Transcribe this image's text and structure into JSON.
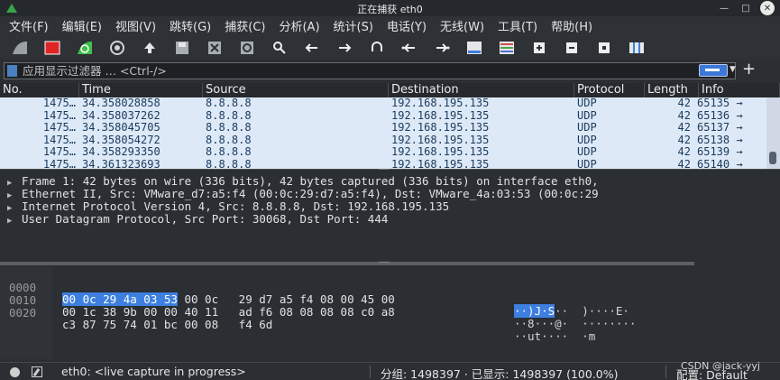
{
  "window": {
    "title": "正在捕获 eth0"
  },
  "menu": [
    "文件(F)",
    "编辑(E)",
    "视图(V)",
    "跳转(G)",
    "捕获(C)",
    "分析(A)",
    "统计(S)",
    "电话(Y)",
    "无线(W)",
    "工具(T)",
    "帮助(H)"
  ],
  "toolbar": {
    "icons": [
      "shark-fin-start-icon",
      "stop-capture-icon",
      "restart-capture-icon",
      "capture-options-icon",
      "open-file-icon",
      "save-file-icon",
      "close-file-icon",
      "reload-file-icon",
      "find-packet-icon",
      "go-back-icon",
      "go-forward-icon",
      "go-to-packet-icon",
      "first-packet-icon",
      "last-packet-icon",
      "auto-scroll-icon",
      "colorize-icon",
      "zoom-in-icon",
      "zoom-out-icon",
      "normal-size-icon",
      "resize-columns-icon"
    ]
  },
  "filter": {
    "placeholder": "应用显示过滤器 … <Ctrl-/>",
    "value": ""
  },
  "packet_list": {
    "columns": [
      "No.",
      "Time",
      "Source",
      "Destination",
      "Protocol",
      "Length",
      "Info"
    ],
    "rows": [
      {
        "no": "1475…",
        "time": "34.358028858",
        "src": "8.8.8.8",
        "dst": "192.168.195.135",
        "proto": "UDP",
        "len": "42",
        "info": "65135 →"
      },
      {
        "no": "1475…",
        "time": "34.358037262",
        "src": "8.8.8.8",
        "dst": "192.168.195.135",
        "proto": "UDP",
        "len": "42",
        "info": "65136 →"
      },
      {
        "no": "1475…",
        "time": "34.358045705",
        "src": "8.8.8.8",
        "dst": "192.168.195.135",
        "proto": "UDP",
        "len": "42",
        "info": "65137 →"
      },
      {
        "no": "1475…",
        "time": "34.358054272",
        "src": "8.8.8.8",
        "dst": "192.168.195.135",
        "proto": "UDP",
        "len": "42",
        "info": "65138 →"
      },
      {
        "no": "1475…",
        "time": "34.358293350",
        "src": "8.8.8.8",
        "dst": "192.168.195.135",
        "proto": "UDP",
        "len": "42",
        "info": "65139 →"
      },
      {
        "no": "1475…",
        "time": "34.361323693",
        "src": "8.8.8.8",
        "dst": "192.168.195.135",
        "proto": "UDP",
        "len": "42",
        "info": "65140 →"
      }
    ]
  },
  "details": [
    "Frame 1: 42 bytes on wire (336 bits), 42 bytes captured (336 bits) on interface eth0,",
    "Ethernet II, Src: VMware_d7:a5:f4 (00:0c:29:d7:a5:f4), Dst: VMware_4a:03:53 (00:0c:29",
    "Internet Protocol Version 4, Src: 8.8.8.8, Dst: 192.168.195.135",
    "User Datagram Protocol, Src Port: 30068, Dst Port: 444"
  ],
  "hex": [
    {
      "offset": "0000",
      "sel": "00 0c 29 4a 03 53",
      "rest": " 00 0c   29 d7 a5 f4 08 00 45 00",
      "ascii_sel": "··)J·S",
      "ascii_rest": "··  )····E·"
    },
    {
      "offset": "0010",
      "sel": "",
      "rest": "00 1c 38 9b 00 00 40 11   ad f6 08 08 08 08 c0 a8",
      "ascii_sel": "",
      "ascii_rest": "··8···@·  ········"
    },
    {
      "offset": "0020",
      "sel": "",
      "rest": "c3 87 75 74 01 bc 00 08   f4 6d",
      "ascii_sel": "",
      "ascii_rest": "··ut····  ·m"
    }
  ],
  "status": {
    "interface": "eth0: <live capture in progress>",
    "packets": "分组: 1498397 · 已显示: 1498397 (100.0%)",
    "profile": "配置: Default"
  },
  "watermark": "CSDN @jack-yyj",
  "colors": {
    "selected_row": "#dde9f7",
    "accent": "#3d7fe0"
  }
}
